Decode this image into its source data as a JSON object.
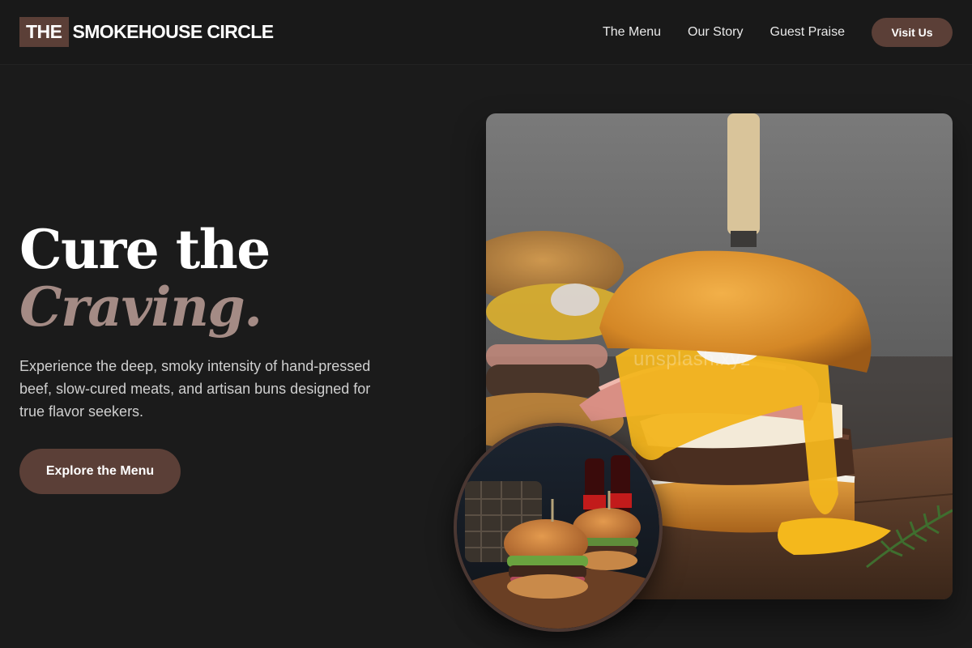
{
  "header": {
    "logo_prefix": "THE",
    "logo_name": "SMOKEHOUSE CIRCLE",
    "nav": [
      {
        "label": "The Menu"
      },
      {
        "label": "Our Story"
      },
      {
        "label": "Guest Praise"
      }
    ],
    "visit_label": "Visit Us"
  },
  "hero": {
    "headline_line1": "Cure the",
    "headline_line2": "Craving.",
    "subtext": "Experience the deep, smoky intensity of hand-pressed beef, slow-cured meats, and artisan buns designed for true flavor seekers.",
    "cta_label": "Explore the Menu",
    "watermark": "unsplash.xyz"
  },
  "colors": {
    "background": "#1b1b1b",
    "accent_brown": "#5b3f37",
    "headline_accent": "#a48b85",
    "text_muted": "#cfcfcf"
  },
  "images": {
    "main": "burger-with-cheese-and-ham-photo",
    "inset": "two-burgers-with-soda-bottles-photo"
  }
}
